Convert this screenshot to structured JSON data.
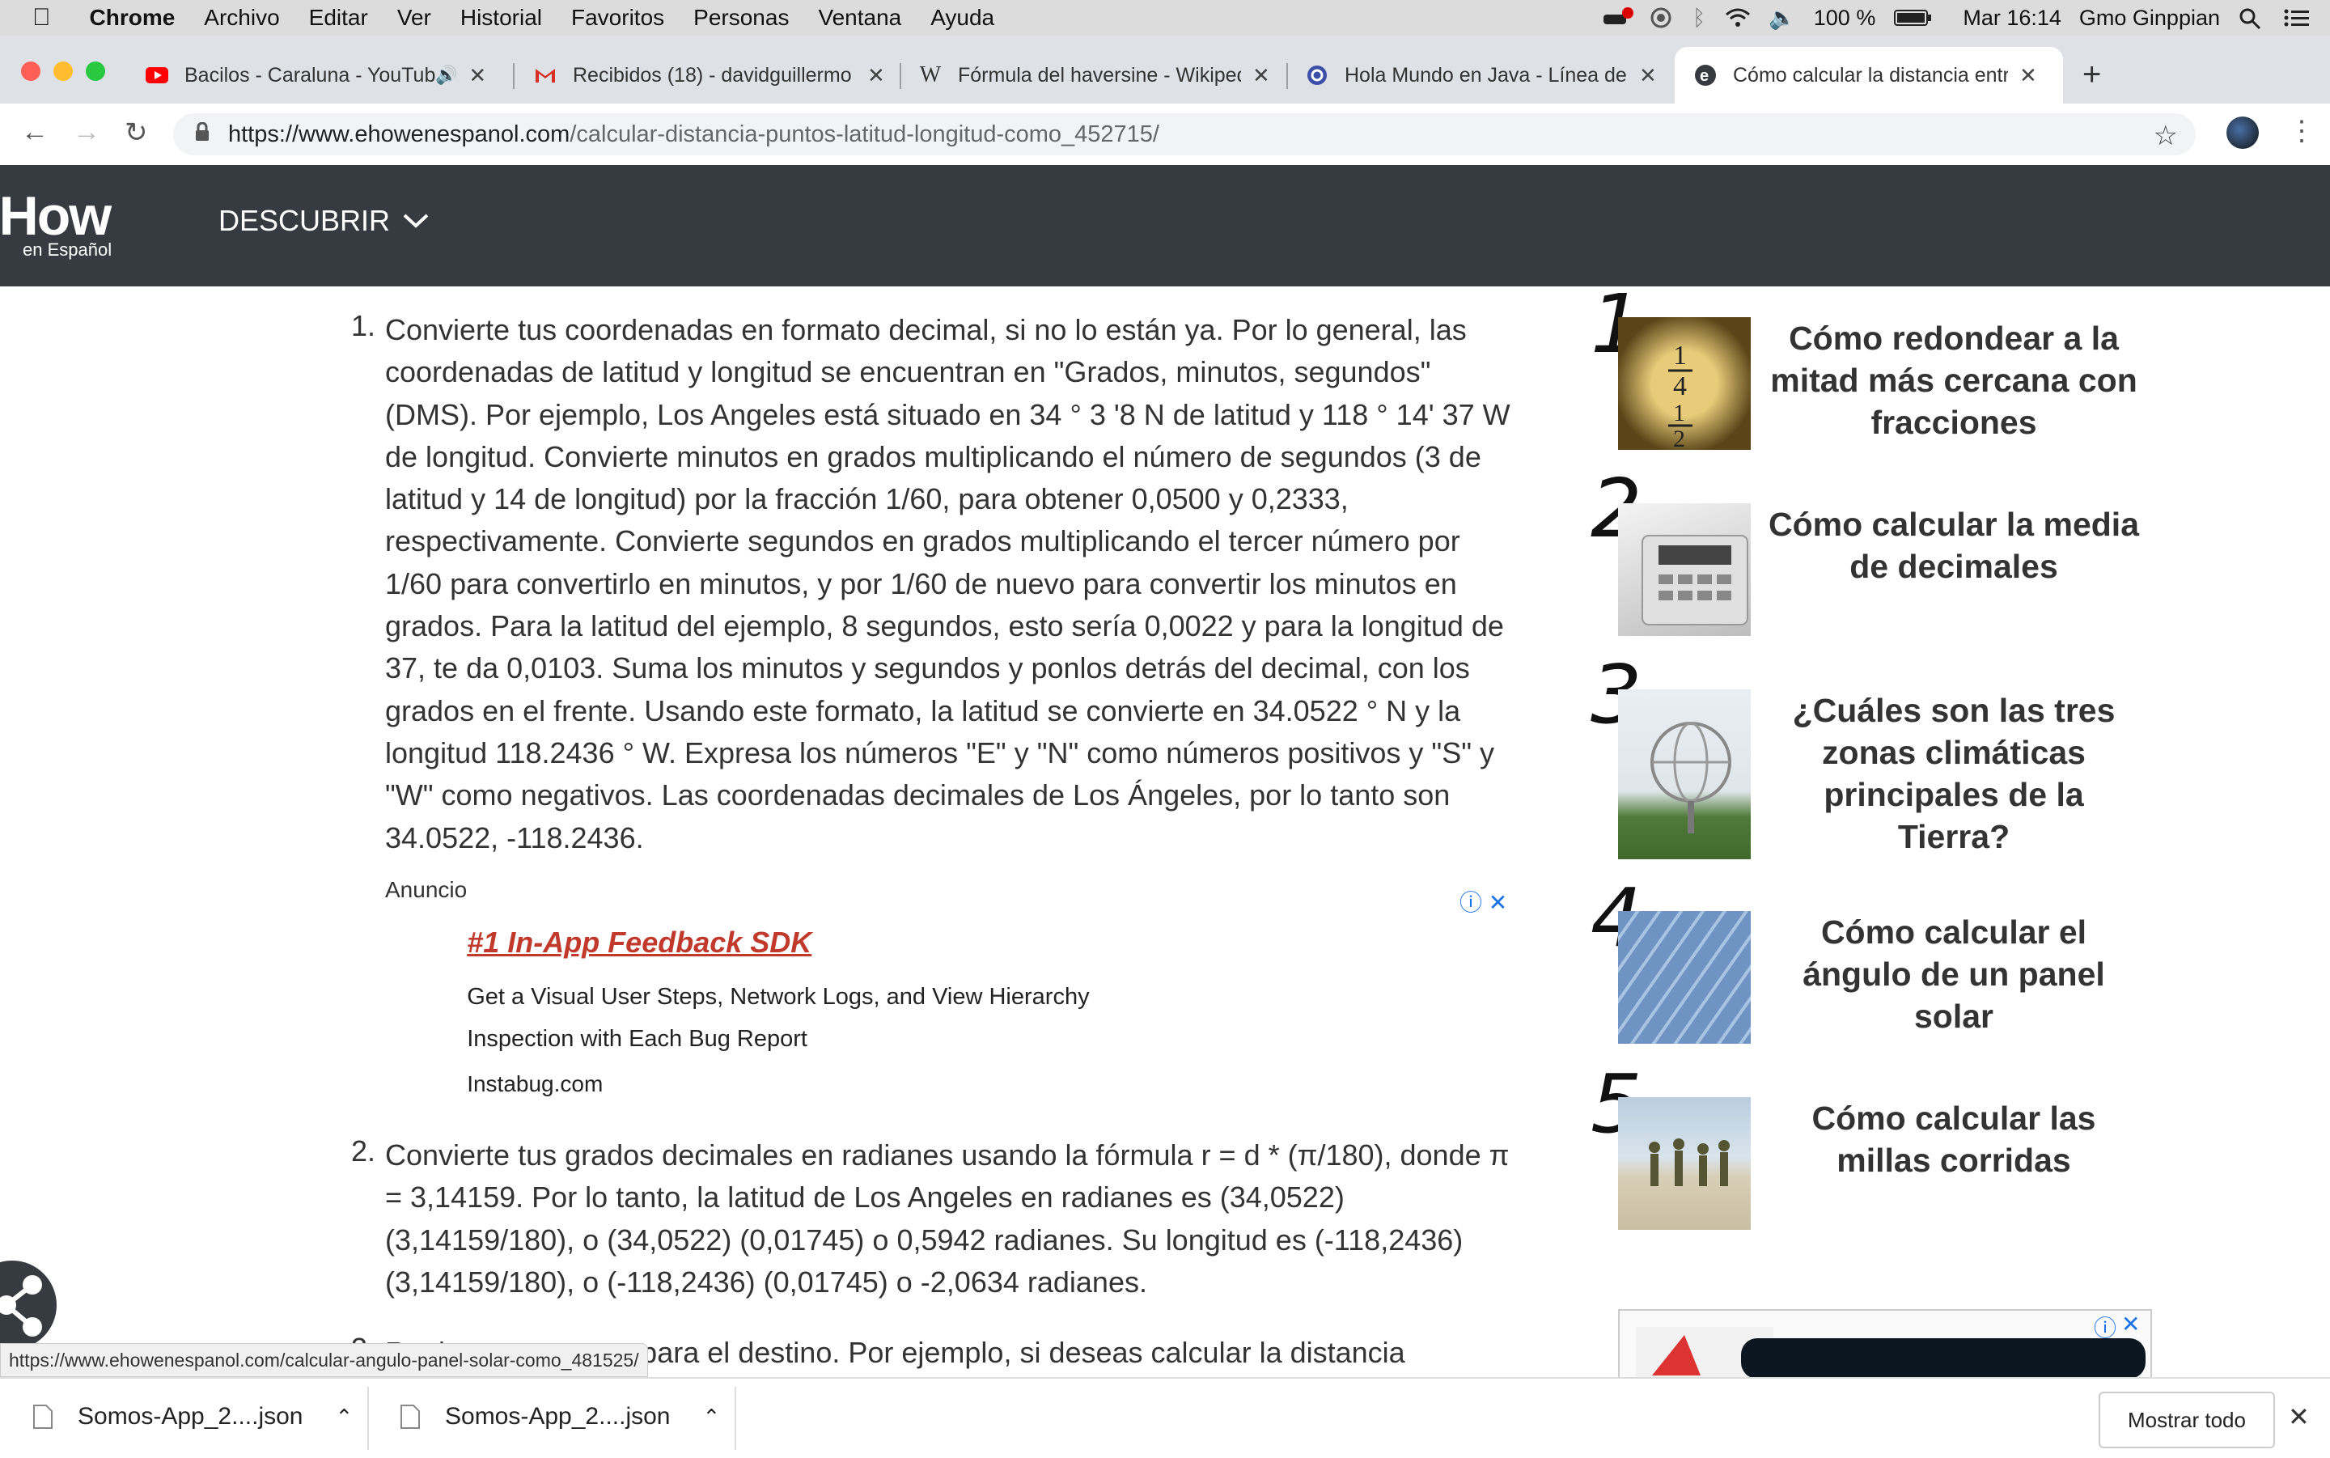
{
  "menubar": {
    "app": "Chrome",
    "items": [
      "Archivo",
      "Editar",
      "Ver",
      "Historial",
      "Favoritos",
      "Personas",
      "Ventana",
      "Ayuda"
    ],
    "battery": "100 %",
    "clock": "Mar 16:14",
    "user": "Gmo Ginppian"
  },
  "tabs": [
    {
      "title": "Bacilos - Caraluna - YouTube",
      "icon": "youtube-icon"
    },
    {
      "title": "Recibidos (18) - davidguillermo",
      "icon": "gmail-icon"
    },
    {
      "title": "Fórmula del haversine - Wikipedia",
      "icon": "wikipedia-icon"
    },
    {
      "title": "Hola Mundo en Java - Línea de",
      "icon": "site-icon"
    },
    {
      "title": "Cómo calcular la distancia entre",
      "icon": "ehow-icon"
    }
  ],
  "address": {
    "host": "https://www.ehowenespanol.com",
    "path": "/calcular-distancia-puntos-latitud-longitud-como_452715/"
  },
  "site": {
    "logo": "How",
    "logo_sub": "en Español",
    "nav_discover": "DESCUBRIR"
  },
  "article": {
    "step1_num": "1.",
    "step1": "Convierte tus coordenadas en formato decimal, si no lo están ya. Por lo general, las coordenadas de latitud y longitud se encuentran en \"Grados, minutos, segundos\" (DMS). Por ejemplo, Los Angeles está situado en 34 ° 3 '8 N de latitud y 118 ° 14' 37 W de longitud. Convierte minutos en grados multiplicando el número de segundos (3 de latitud y 14 de longitud) por la fracción 1/60, para obtener 0,0500 y 0,2333, respectivamente. Convierte segundos en grados multiplicando el tercer número por 1/60 para convertirlo en minutos, y por 1/60 de nuevo para convertir los minutos en grados. Para la latitud del ejemplo, 8 segundos, esto sería 0,0022 y para la longitud de 37, te da 0,0103. Suma los minutos y segundos y ponlos detrás del decimal, con los grados en el frente. Usando este formato, la latitud se convierte en 34.0522 ° N y la longitud 118.2436 ° W. Expresa los números \"E\" y \"N\" como números positivos y \"S\" y \"W\" como negativos. Las coordenadas decimales de Los Ángeles, por lo tanto son 34.0522, -118.2436.",
    "step2_num": "2.",
    "step2": "Convierte tus grados decimales en radianes usando la fórmula r = d * (π/180), donde π = 3,14159. Por lo tanto, la latitud de Los Angeles en radianes es (34,0522) (3,14159/180), o (34,0522) (0,01745) o 0,5942 radianes. Su longitud es (-118,2436) (3,14159/180), o (-118,2436) (0,01745) o -2,0634 radianes.",
    "step3_num": "3.",
    "step3": "Repite estos pasos para el destino. Por ejemplo, si deseas calcular la distancia"
  },
  "ad": {
    "label": "Anuncio",
    "title": "#1 In-App Feedback SDK",
    "desc1": "Get a Visual User Steps, Network Logs, and View Hierarchy",
    "desc2": "Inspection with Each Bug Report",
    "domain": "Instabug.com"
  },
  "sidebar": [
    {
      "rank": "1",
      "title": "Cómo redondear a la mitad más cercana con fracciones"
    },
    {
      "rank": "2",
      "title": "Cómo calcular la media de decimales"
    },
    {
      "rank": "3",
      "title": "¿Cuáles son las tres zonas climáticas principales de la Tierra?"
    },
    {
      "rank": "4",
      "title": "Cómo calcular el ángulo de un panel solar"
    },
    {
      "rank": "5",
      "title": "Cómo calcular las millas corridas"
    }
  ],
  "status_url": "https://www.ehowenespanol.com/calcular-angulo-panel-solar-como_481525/",
  "downloads": {
    "items": [
      "Somos-App_2....json",
      "Somos-App_2....json"
    ],
    "show_all": "Mostrar todo"
  },
  "colors": {
    "header": "#353b41",
    "ad_title": "#c0392b",
    "adchoices": "#1a73e8"
  }
}
